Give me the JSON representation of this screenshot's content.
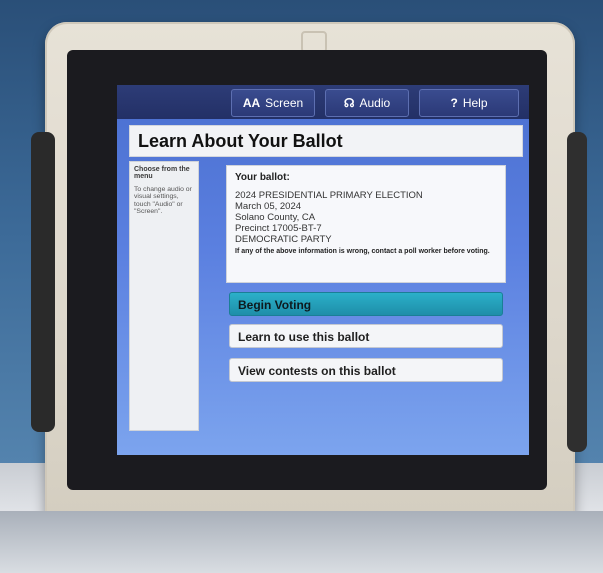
{
  "topbar": {
    "screen_label": "Screen",
    "audio_label": "Audio",
    "help_label": "Help",
    "screen_icon": "AA",
    "audio_icon": "audio-icon",
    "help_icon": "?"
  },
  "page": {
    "title": "Learn About Your Ballot"
  },
  "sidebar": {
    "title": "Choose from the menu",
    "text": "To change audio or visual settings, touch \"Audio\" or \"Screen\"."
  },
  "ballot": {
    "heading": "Your ballot:",
    "election": "2024 PRESIDENTIAL PRIMARY ELECTION",
    "date": "March 05, 2024",
    "county": "Solano County, CA",
    "precinct": "Precinct 17005-BT-7",
    "party": "DEMOCRATIC PARTY",
    "note": "If any of the above information is wrong, contact a poll worker before voting."
  },
  "actions": {
    "begin": "Begin Voting",
    "learn": "Learn to use this ballot",
    "view": "View contests on this ballot"
  },
  "colors": {
    "screen_blue": "#5b80e0",
    "accent_teal": "#1e8ea9",
    "topbar": "#233066"
  }
}
